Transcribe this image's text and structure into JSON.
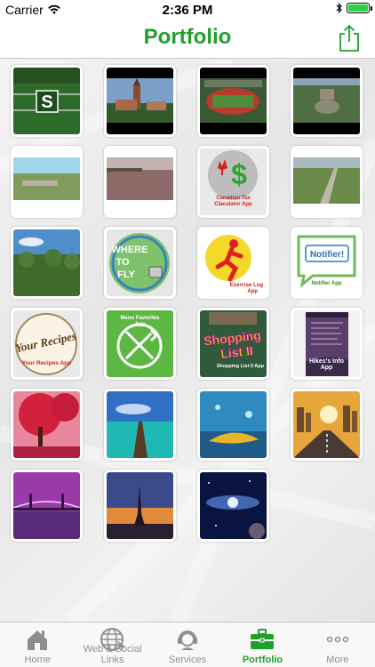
{
  "status_bar": {
    "carrier": "Carrier",
    "time": "2:36 PM"
  },
  "nav": {
    "title": "Portfolio"
  },
  "colors": {
    "accent": "#1fa02a",
    "tab_inactive": "#8e8e8e",
    "battery": "#2bd14b"
  },
  "tiles": {
    "t7": {
      "line1": "Canadian Tax",
      "line2": "Claculator App"
    },
    "t8": {
      "line1": "Notifier!",
      "line2": "Notifier App"
    },
    "t11": {
      "line1": "Exercise Log",
      "line2": "App"
    },
    "t12": {
      "line1": "Notifier!",
      "line2": "Notifier App"
    },
    "t13": {
      "line1": "Your Recipes",
      "line2": "Your Recipes App"
    },
    "t14": {
      "line1": "Menu Favorites",
      "line2": "App"
    },
    "t15": {
      "line1": "Shopping List II",
      "line2": "Shopping List II App"
    },
    "t16": {
      "line1": "Hikes's Info",
      "line2": "App"
    },
    "where": {
      "line1": "WHERE",
      "line2": "TO",
      "line3": "FLY"
    }
  },
  "tabs": [
    {
      "label": "Home",
      "icon": "house-icon"
    },
    {
      "label": "Web & Social Links",
      "icon": "globe-icon"
    },
    {
      "label": "Services",
      "icon": "headset-icon"
    },
    {
      "label": "Portfolio",
      "icon": "briefcase-icon"
    },
    {
      "label": "More",
      "icon": "more-dots-icon"
    }
  ]
}
